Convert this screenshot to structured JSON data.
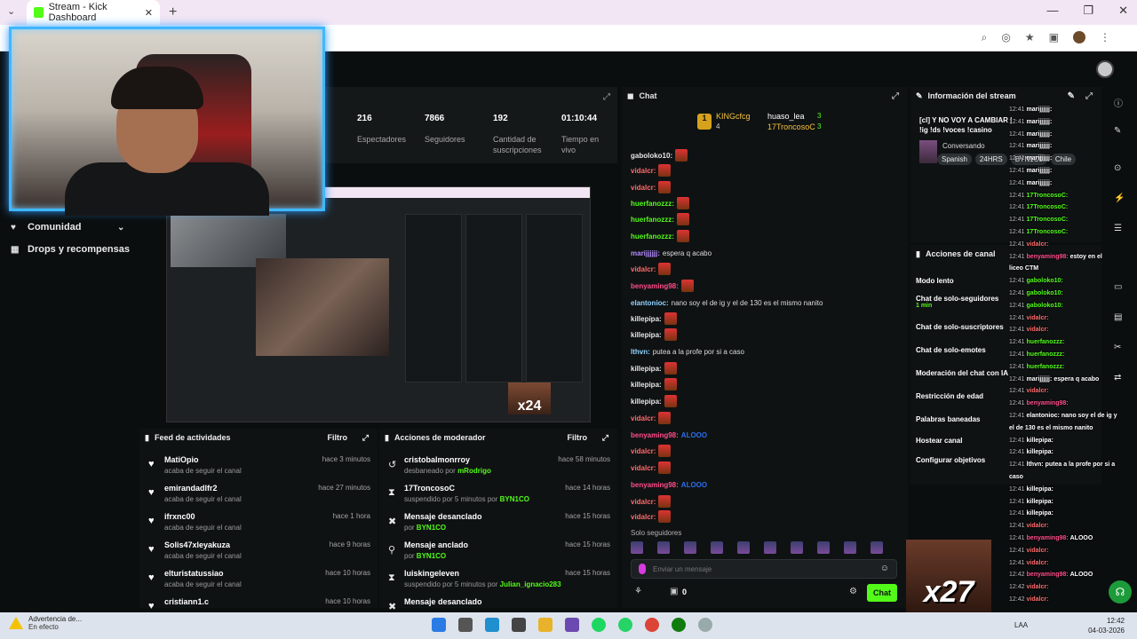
{
  "browser": {
    "tab_title": "Stream - Kick Dashboard",
    "tab_close": "✕",
    "new_tab": "+",
    "window_controls": [
      "—",
      "❐",
      "✕"
    ]
  },
  "nav": {
    "items": [
      {
        "label": "Comunidad",
        "icon": "heart-icon",
        "has_chevron": true
      },
      {
        "label": "Drops y recompensas",
        "icon": "gift-icon",
        "has_chevron": false
      }
    ],
    "partial_label": "m"
  },
  "stats": [
    {
      "value": "216",
      "label": "Espectadores"
    },
    {
      "value": "7866",
      "label": "Seguidores"
    },
    {
      "value": "192",
      "label": "Cantidad de suscripciones"
    },
    {
      "value": "01:10:44",
      "label": "Tiempo en vivo"
    }
  ],
  "preview": {
    "overlay_text": "x24"
  },
  "activity_feed": {
    "title": "Feed de actividades",
    "filter": "Filtro",
    "items": [
      {
        "user": "MatiOpio",
        "action": "acaba de seguir el canal",
        "time": "hace 3 minutos"
      },
      {
        "user": "emirandadlfr2",
        "action": "acaba de seguir el canal",
        "time": "hace 27 minutos"
      },
      {
        "user": "ifrxnc00",
        "action": "acaba de seguir el canal",
        "time": "hace 1 hora"
      },
      {
        "user": "Solis47xleyakuza",
        "action": "acaba de seguir el canal",
        "time": "hace 9 horas"
      },
      {
        "user": "elturistatussiao",
        "action": "acaba de seguir el canal",
        "time": "hace 10 horas"
      },
      {
        "user": "cristiann1.c",
        "action": "",
        "time": "hace 10 horas"
      }
    ]
  },
  "mod_actions": {
    "title": "Acciones de moderador",
    "filter": "Filtro",
    "items": [
      {
        "title": "cristobalmonrroy",
        "sub": "desbaneado por",
        "by": "mRodrigo",
        "time": "hace 58 minutos",
        "icon": "undo-icon"
      },
      {
        "title": "17TroncosoC",
        "sub": "suspendido por 5 minutos por",
        "by": "BYN1CO",
        "time": "hace 14 horas",
        "icon": "hourglass-icon"
      },
      {
        "title": "Mensaje desanclado",
        "sub": "por",
        "by": "BYN1CO",
        "time": "hace 15 horas",
        "icon": "unpin-icon"
      },
      {
        "title": "Mensaje anclado",
        "sub": "por",
        "by": "BYN1CO",
        "time": "hace 15 horas",
        "icon": "pin-icon"
      },
      {
        "title": "luiskingeleven",
        "sub": "suspendido por 5 minutos por",
        "by": "Julian_ignacio283",
        "time": "hace 15 horas",
        "icon": "hourglass-icon"
      },
      {
        "title": "Mensaje desanclado",
        "sub": "",
        "by": "",
        "time": "",
        "icon": "unpin-icon"
      }
    ]
  },
  "chat": {
    "title": "Chat",
    "pinned": {
      "user1": "KINGcfcg",
      "count1": "4",
      "user2": "huaso_lea",
      "user3": "17TroncosoC",
      "c1": "3",
      "c2": "3"
    },
    "messages": [
      {
        "user": "gaboloko10:",
        "color": "#e6e6e6",
        "text": "",
        "emotes": 1
      },
      {
        "user": "vidalcr:",
        "color": "#ff6b6b",
        "text": "",
        "emotes": 1
      },
      {
        "user": "vidalcr:",
        "color": "#ff6b6b",
        "text": "",
        "emotes": 1
      },
      {
        "user": "huerfanozzz:",
        "color": "#53fc18",
        "text": "",
        "emotes": 1
      },
      {
        "user": "huerfanozzz:",
        "color": "#53fc18",
        "text": "",
        "emotes": 1
      },
      {
        "user": "huerfanozzz:",
        "color": "#53fc18",
        "text": "",
        "emotes": 1
      },
      {
        "user": "marijjjjjj:",
        "color": "#b48cff",
        "text": "espera q acabo",
        "emotes": 0
      },
      {
        "user": "vidalcr:",
        "color": "#ff6b6b",
        "text": "",
        "emotes": 1
      },
      {
        "user": "benyaming98:",
        "color": "#ff4d88",
        "text": "",
        "emotes": 1
      },
      {
        "user": "elantonioc:",
        "color": "#8fd3ff",
        "text": "nano soy el de ig y el de 130 es el mismo nanito",
        "emotes": 0
      },
      {
        "user": "killepipa:",
        "color": "#e6e6e6",
        "text": "",
        "emotes": 1
      },
      {
        "user": "killepipa:",
        "color": "#e6e6e6",
        "text": "",
        "emotes": 1
      },
      {
        "user": "lthvn:",
        "color": "#8fd3ff",
        "text": "putea a la profe por si a caso",
        "emotes": 0
      },
      {
        "user": "killepipa:",
        "color": "#e6e6e6",
        "text": "",
        "emotes": 1
      },
      {
        "user": "killepipa:",
        "color": "#e6e6e6",
        "text": "",
        "emotes": 1
      },
      {
        "user": "killepipa:",
        "color": "#e6e6e6",
        "text": "",
        "emotes": 1
      },
      {
        "user": "vidalcr:",
        "color": "#ff6b6b",
        "text": "",
        "emotes": 1
      },
      {
        "user": "benyaming98:",
        "color": "#ff4d88",
        "text": "ALOOO",
        "emotes": 0
      },
      {
        "user": "vidalcr:",
        "color": "#ff6b6b",
        "text": "",
        "emotes": 1
      },
      {
        "user": "vidalcr:",
        "color": "#ff6b6b",
        "text": "",
        "emotes": 1
      },
      {
        "user": "benyaming98:",
        "color": "#ff4d88",
        "text": "ALOOO",
        "emotes": 0
      },
      {
        "user": "vidalcr:",
        "color": "#ff6b6b",
        "text": "",
        "emotes": 1
      },
      {
        "user": "vidalcr:",
        "color": "#ff6b6b",
        "text": "",
        "emotes": 1
      }
    ],
    "followers_only_label": "Solo seguidores",
    "input_placeholder": "Enviar un mensaje",
    "points": "0",
    "send_button": "Chat"
  },
  "stream_info": {
    "title": "Información del stream",
    "stream_title": "[cl] Y NO VOY A CAMBIAR | !ig !ds !voces !casino",
    "category": "Conversando",
    "tags": [
      "Spanish",
      "24HRS",
      "BYN1C0",
      "Chile"
    ]
  },
  "channel_actions": {
    "title": "Acciones de canal",
    "items": [
      {
        "label": "Modo lento",
        "small": ""
      },
      {
        "label": "Chat de solo-seguidores",
        "small": "1 min"
      },
      {
        "label": "Chat de solo-suscriptores",
        "small": ""
      },
      {
        "label": "Chat de solo-emotes",
        "small": ""
      },
      {
        "label": "Moderación del chat con IA",
        "small": ""
      },
      {
        "label": "Restricción de edad",
        "small": ""
      },
      {
        "label": "Palabras baneadas",
        "small": ""
      },
      {
        "label": "Hostear canal",
        "small": ""
      },
      {
        "label": "Configurar objetivos",
        "small": ""
      }
    ]
  },
  "overlay_chat": [
    {
      "time": "12:41",
      "user": "marijjjjjj:",
      "text": ""
    },
    {
      "time": "12:41",
      "user": "marijjjjjj:",
      "text": ""
    },
    {
      "time": "12:41",
      "user": "marijjjjjj:",
      "text": ""
    },
    {
      "time": "12:41",
      "user": "marijjjjjj:",
      "text": ""
    },
    {
      "time": "12:41",
      "user": "marijjjjjj:",
      "text": ""
    },
    {
      "time": "12:41",
      "user": "marijjjjjj:",
      "text": ""
    },
    {
      "time": "12:41",
      "user": "marijjjjjj:",
      "text": ""
    },
    {
      "time": "12:41",
      "user": "17TroncosoC:",
      "text": ""
    },
    {
      "time": "12:41",
      "user": "17TroncosoC:",
      "text": ""
    },
    {
      "time": "12:41",
      "user": "17TroncosoC:",
      "text": ""
    },
    {
      "time": "12:41",
      "user": "17TroncosoC:",
      "text": ""
    },
    {
      "time": "12:41",
      "user": "vidalcr:",
      "text": ""
    },
    {
      "time": "12:41",
      "user": "benyaming98:",
      "text": "estoy en el"
    },
    {
      "time": "",
      "user": "",
      "text": "liceo CTM"
    },
    {
      "time": "12:41",
      "user": "gaboloko10:",
      "text": ""
    },
    {
      "time": "12:41",
      "user": "gaboloko10:",
      "text": ""
    },
    {
      "time": "12:41",
      "user": "gaboloko10:",
      "text": ""
    },
    {
      "time": "12:41",
      "user": "vidalcr:",
      "text": ""
    },
    {
      "time": "12:41",
      "user": "vidalcr:",
      "text": ""
    },
    {
      "time": "12:41",
      "user": "huerfanozzz:",
      "text": ""
    },
    {
      "time": "12:41",
      "user": "huerfanozzz:",
      "text": ""
    },
    {
      "time": "12:41",
      "user": "huerfanozzz:",
      "text": ""
    },
    {
      "time": "12:41",
      "user": "marijjjjjj:",
      "text": "espera q acabo"
    },
    {
      "time": "12:41",
      "user": "vidalcr:",
      "text": ""
    },
    {
      "time": "12:41",
      "user": "benyaming98:",
      "text": ""
    },
    {
      "time": "12:41",
      "user": "elantonioc:",
      "text": "nano soy el de ig y"
    },
    {
      "time": "",
      "user": "",
      "text": "el de 130 es el mismo nanito"
    },
    {
      "time": "12:41",
      "user": "killepipa:",
      "text": ""
    },
    {
      "time": "12:41",
      "user": "killepipa:",
      "text": ""
    },
    {
      "time": "12:41",
      "user": "lthvn:",
      "text": "putea a la profe por si a"
    },
    {
      "time": "",
      "user": "",
      "text": "caso"
    },
    {
      "time": "12:41",
      "user": "killepipa:",
      "text": ""
    },
    {
      "time": "12:41",
      "user": "killepipa:",
      "text": ""
    },
    {
      "time": "12:41",
      "user": "killepipa:",
      "text": ""
    },
    {
      "time": "12:41",
      "user": "vidalcr:",
      "text": ""
    },
    {
      "time": "12:41",
      "user": "benyaming98:",
      "text": "ALOOO"
    },
    {
      "time": "12:41",
      "user": "vidalcr:",
      "text": ""
    },
    {
      "time": "12:41",
      "user": "vidalcr:",
      "text": ""
    },
    {
      "time": "12:42",
      "user": "benyaming98:",
      "text": "ALOOO"
    },
    {
      "time": "12:42",
      "user": "vidalcr:",
      "text": ""
    },
    {
      "time": "12:42",
      "user": "vidalcr:",
      "text": ""
    }
  ],
  "overlay_x27": "x27",
  "taskbar": {
    "warning_title": "Advertencia de...",
    "warning_sub": "En efecto",
    "lang": "LAA",
    "time": "12:42",
    "date": "04-03-2026"
  }
}
